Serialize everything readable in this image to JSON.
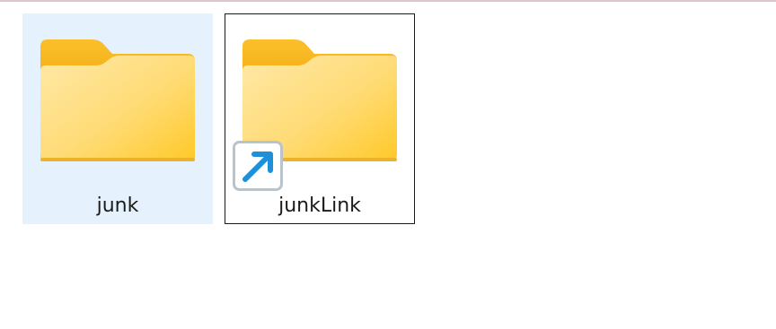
{
  "items": [
    {
      "name": "junk",
      "icon": "folder-icon",
      "state": "selected"
    },
    {
      "name": "junkLink",
      "icon": "folder-icon",
      "overlay": "shortcut-arrow-icon",
      "state": "focused"
    }
  ],
  "colors": {
    "selection_bg": "#e5f2fd",
    "focus_border": "#1a1a1a",
    "folder_body": "#ffd769",
    "folder_back": "#f7b721",
    "shortcut_arrow": "#1e8fd9"
  }
}
